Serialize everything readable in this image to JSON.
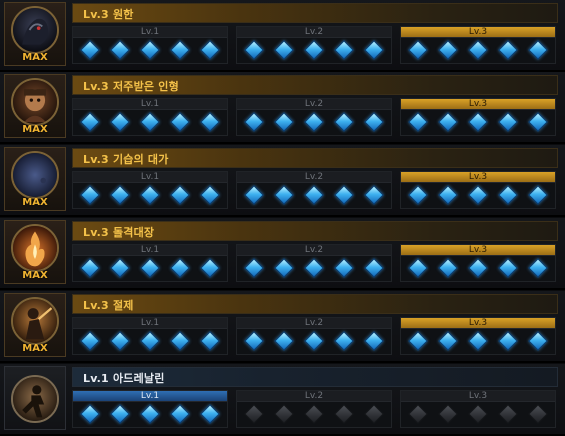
{
  "colors": {
    "gold_accent": "#f0b432",
    "gem_blue": "#3fb2f0",
    "locked_gem": "#2e3035"
  },
  "skills": [
    {
      "title": "Lv.3 원한",
      "badge": "MAX",
      "icon": "shadow-beast-icon",
      "levels": [
        {
          "label": "Lv.1",
          "state": "inactive",
          "gems": "lit"
        },
        {
          "label": "Lv.2",
          "state": "inactive",
          "gems": "lit"
        },
        {
          "label": "Lv.3",
          "state": "active-gold",
          "gems": "lit"
        }
      ]
    },
    {
      "title": "Lv.3 저주받은 인형",
      "badge": "MAX",
      "icon": "cursed-doll-icon",
      "levels": [
        {
          "label": "Lv.1",
          "state": "inactive",
          "gems": "lit"
        },
        {
          "label": "Lv.2",
          "state": "inactive",
          "gems": "lit"
        },
        {
          "label": "Lv.3",
          "state": "active-gold",
          "gems": "lit"
        }
      ]
    },
    {
      "title": "Lv.3 기습의 대가",
      "badge": "MAX",
      "icon": "crescent-moon-icon",
      "levels": [
        {
          "label": "Lv.1",
          "state": "inactive",
          "gems": "lit"
        },
        {
          "label": "Lv.2",
          "state": "inactive",
          "gems": "lit"
        },
        {
          "label": "Lv.3",
          "state": "active-gold",
          "gems": "lit"
        }
      ]
    },
    {
      "title": "Lv.3 돌격대장",
      "badge": "MAX",
      "icon": "flame-charge-icon",
      "levels": [
        {
          "label": "Lv.1",
          "state": "inactive",
          "gems": "lit"
        },
        {
          "label": "Lv.2",
          "state": "inactive",
          "gems": "lit"
        },
        {
          "label": "Lv.3",
          "state": "active-gold",
          "gems": "lit"
        }
      ]
    },
    {
      "title": "Lv.3 절제",
      "badge": "MAX",
      "icon": "warrior-strike-icon",
      "levels": [
        {
          "label": "Lv.1",
          "state": "inactive",
          "gems": "lit"
        },
        {
          "label": "Lv.2",
          "state": "inactive",
          "gems": "lit"
        },
        {
          "label": "Lv.3",
          "state": "active-gold",
          "gems": "lit"
        }
      ]
    },
    {
      "title": "Lv.1 아드레날린",
      "badge": "",
      "icon": "running-warrior-icon",
      "levels": [
        {
          "label": "Lv.1",
          "state": "active-blue",
          "gems": "lit"
        },
        {
          "label": "Lv.2",
          "state": "inactive",
          "gems": "dim"
        },
        {
          "label": "Lv.3",
          "state": "inactive",
          "gems": "dim"
        }
      ]
    }
  ]
}
